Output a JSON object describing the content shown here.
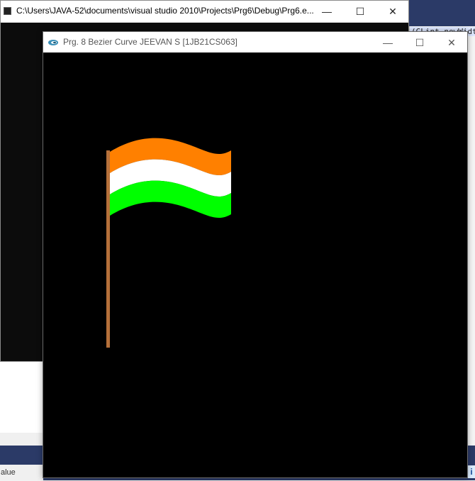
{
  "console_window": {
    "title": "C:\\Users\\JAVA-52\\documents\\visual studio 2010\\Projects\\Prg6\\Debug\\Prg6.e...",
    "minimize_label": "—",
    "maximize_label": "☐",
    "close_label": "✕"
  },
  "gl_window": {
    "title": "Prg. 8 Bezier Curve JEEVAN S [1JB21CS063]",
    "minimize_label": "—",
    "maximize_label": "☐",
    "close_label": "✕",
    "icon": "opengl-glut-icon"
  },
  "ide": {
    "code_snippet": "(GLint newWidth",
    "bottom_panel_text": "alue",
    "info_icon": "i"
  },
  "flag": {
    "stripes": [
      {
        "name": "saffron",
        "color": "#ff8000"
      },
      {
        "name": "white",
        "color": "#ffffff"
      },
      {
        "name": "green",
        "color": "#00ff00"
      }
    ],
    "pole_color": "#b5703a"
  }
}
